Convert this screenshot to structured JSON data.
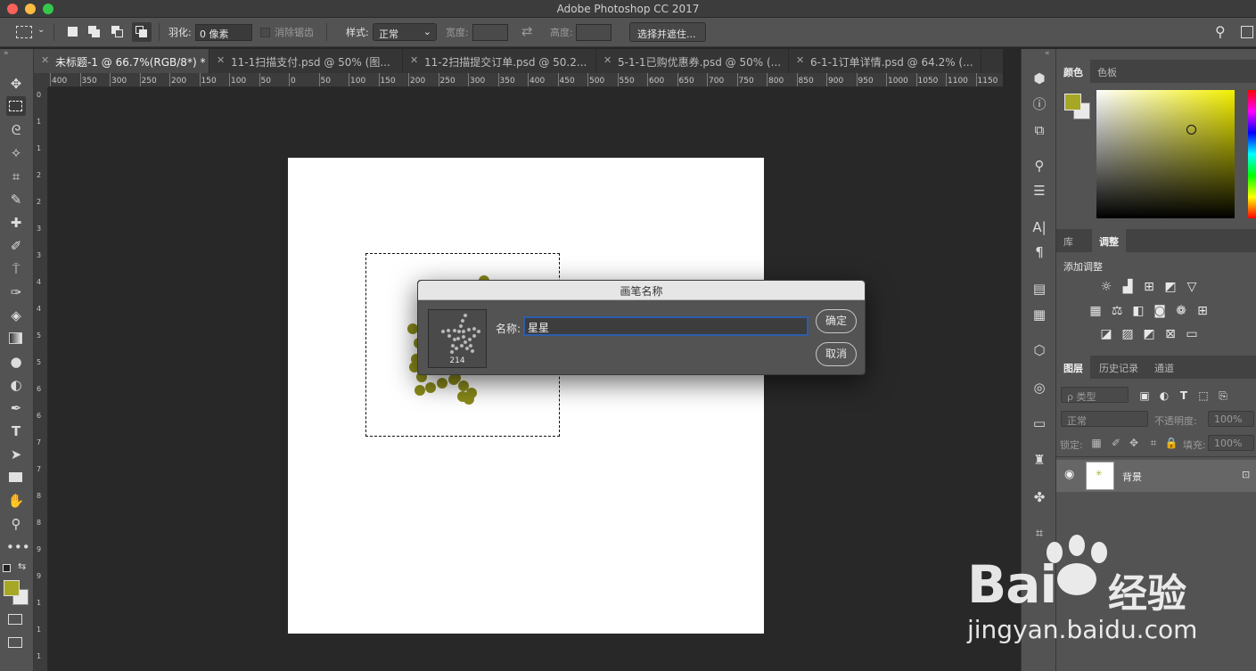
{
  "window": {
    "title": "Adobe Photoshop CC 2017"
  },
  "options_bar": {
    "feather_label": "羽化:",
    "feather_value": "0 像素",
    "antialias_label": "消除锯齿",
    "style_label": "样式:",
    "style_value": "正常",
    "width_label": "宽度:",
    "height_label": "高度:",
    "select_mask_button": "选择并遮住..."
  },
  "tabs": [
    {
      "label": "未标题-1 @ 66.7%(RGB/8*) *",
      "active": true
    },
    {
      "label": "11-1扫描支付.psd @ 50% (图...",
      "active": false
    },
    {
      "label": "11-2扫描提交订单.psd @ 50.2...",
      "active": false
    },
    {
      "label": "5-1-1已购优惠券.psd @ 50% (...",
      "active": false
    },
    {
      "label": "6-1-1订单详情.psd @ 64.2% (...",
      "active": false
    }
  ],
  "ruler": {
    "top_ticks": [
      "400",
      "350",
      "300",
      "250",
      "200",
      "150",
      "100",
      "50",
      "0",
      "50",
      "100",
      "150",
      "200",
      "250",
      "300",
      "350",
      "400",
      "450",
      "500",
      "550",
      "600",
      "650",
      "700",
      "750",
      "800",
      "850",
      "900",
      "950",
      "1000",
      "1050",
      "1100",
      "1150"
    ],
    "left_ticks": [
      "0",
      "1",
      "1",
      "2",
      "2",
      "3",
      "3",
      "4",
      "4",
      "5",
      "5",
      "6",
      "6",
      "7",
      "7",
      "8",
      "8",
      "9",
      "9",
      "1",
      "1",
      "1"
    ]
  },
  "dialog": {
    "title": "画笔名称",
    "brush_size": "214",
    "name_label": "名称:",
    "name_value": "星星",
    "ok_button": "确定",
    "cancel_button": "取消"
  },
  "panels": {
    "color_tabs": [
      "颜色",
      "色板"
    ],
    "adjust_tabs": [
      "库",
      "调整"
    ],
    "adjust_title": "添加调整",
    "layer_tabs": [
      "图层",
      "历史记录",
      "通道"
    ],
    "filter_label": "ρ 类型",
    "blend_mode": "正常",
    "opacity_label": "不透明度:",
    "opacity_value": "100%",
    "lock_label": "锁定:",
    "fill_label": "填充:",
    "fill_value": "100%",
    "layer_name": "背景"
  },
  "colors": {
    "foreground": "#a7a726",
    "background": "#e9e9e9",
    "brush_dots": "#8a8a1a"
  },
  "watermark": {
    "brand": "Bai",
    "brand_cn": "经验",
    "url": "jingyan.baidu.com"
  }
}
